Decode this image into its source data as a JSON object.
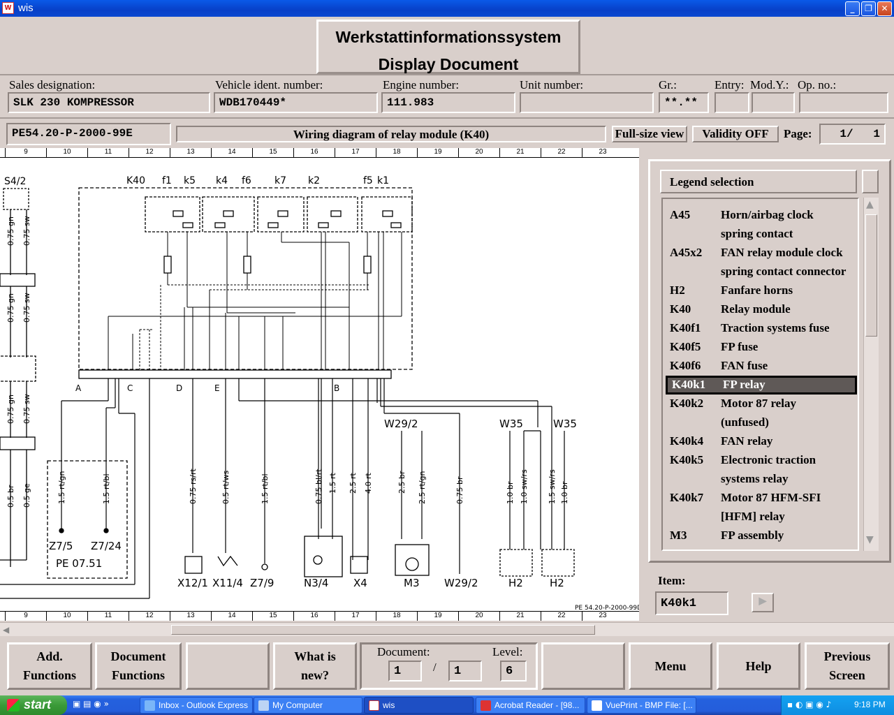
{
  "window": {
    "title": "wis"
  },
  "header": {
    "line1": "Werkstattinformationssystem",
    "line2": "Display Document"
  },
  "vehicle": {
    "sales_label": "Sales designation:",
    "sales_value": "SLK 230 KOMPRESSOR",
    "vin_label": "Vehicle ident. number:",
    "vin_value": "WDB170449*",
    "engine_label": "Engine number:",
    "engine_value": "111.983",
    "unit_label": "Unit number:",
    "unit_value": "",
    "gr_label": "Gr.:",
    "gr_value": "**.**",
    "entry_label": "Entry:",
    "entry_value": "",
    "mody_label": "Mod.Y.:",
    "mody_value": "",
    "opno_label": "Op. no.:",
    "opno_value": ""
  },
  "doc": {
    "id": "PE54.20-P-2000-99E",
    "title": "Wiring diagram of relay module (K40)",
    "fullsize": "Full-size view",
    "validity": "Validity OFF",
    "page_label": "Page:",
    "page_value": "1/   1"
  },
  "ruler": [
    "9",
    "10",
    "11",
    "12",
    "13",
    "14",
    "15",
    "16",
    "17",
    "18",
    "19",
    "20",
    "21",
    "22",
    "23"
  ],
  "diagram": {
    "footer_ref": "PE 54.20-P-2000-99D",
    "components": [
      "S4/2",
      "K40",
      "f1",
      "k5",
      "k4",
      "f6",
      "k7",
      "k2",
      "f5",
      "k1"
    ],
    "pins_top": [
      "A",
      "C",
      "D",
      "E",
      "B"
    ],
    "connectors": [
      "Z7/5",
      "Z7/24",
      "PE 07.51",
      "X12/1",
      "X11/4",
      "Z7/9",
      "N3/4",
      "X4",
      "M3",
      "W29/2",
      "H2",
      "H2",
      "W29/2",
      "W35",
      "W35"
    ],
    "wires": [
      "0.75 gn",
      "0.75 sw",
      "0.75 gn",
      "0.75 sw",
      "0.75 gn",
      "0.75 sw",
      "1.5 rt/gn",
      "1.5 rt/bl",
      "0.75 rs/rt",
      "0.5 rt/ws",
      "1.5 rt/bl",
      "0.75 bl/rt",
      "1.5 rt",
      "2.5 rt",
      "4.0 rt",
      "2.5 br",
      "2.5 rt/gn",
      "0.75 br",
      "1.0 br",
      "1.0 sw/rs",
      "1.5 sw/rs",
      "1.0 br",
      "0.5 br",
      "0.5 ge"
    ]
  },
  "legend": {
    "header": "Legend selection",
    "rows": [
      {
        "code": "A45",
        "desc": "Horn/airbag clock"
      },
      {
        "code": "",
        "desc": "spring contact"
      },
      {
        "code": "A45x2",
        "desc": "FAN relay module clock"
      },
      {
        "code": "",
        "desc": "spring contact connector"
      },
      {
        "code": "H2",
        "desc": "Fanfare horns"
      },
      {
        "code": "K40",
        "desc": "Relay module"
      },
      {
        "code": "K40f1",
        "desc": "Traction systems fuse"
      },
      {
        "code": "K40f5",
        "desc": "FP fuse"
      },
      {
        "code": "K40f6",
        "desc": "FAN fuse"
      },
      {
        "code": "K40k1",
        "desc": "FP relay",
        "selected": true
      },
      {
        "code": "K40k2",
        "desc": "Motor 87 relay"
      },
      {
        "code": "",
        "desc": "(unfused)"
      },
      {
        "code": "K40k4",
        "desc": "FAN relay"
      },
      {
        "code": "K40k5",
        "desc": "Electronic traction"
      },
      {
        "code": "",
        "desc": "systems relay"
      },
      {
        "code": "K40k7",
        "desc": "Motor 87 HFM-SFI"
      },
      {
        "code": "",
        "desc": "[HFM] relay"
      },
      {
        "code": "M3",
        "desc": "FP assembly"
      }
    ],
    "item_label": "Item:",
    "item_value": "K40k1"
  },
  "bottom": {
    "add_functions": [
      "Add.",
      "Functions"
    ],
    "document_functions": [
      "Document",
      "Functions"
    ],
    "what_is_new": [
      "What is",
      "new?"
    ],
    "document_label": "Document:",
    "document_value": "1",
    "document_sep": "/",
    "document_total": "1",
    "level_label": "Level:",
    "level_value": "6",
    "menu": "Menu",
    "help": "Help",
    "previous_screen": [
      "Previous",
      "Screen"
    ]
  },
  "taskbar": {
    "start": "start",
    "tasks": [
      "Inbox - Outlook Express",
      "My Computer",
      "wis",
      "Acrobat Reader - [98...",
      "VuePrint - BMP File: [..."
    ],
    "time": "9:18 PM"
  },
  "colors": {
    "panel": "#d9cfcb",
    "titlebar": "#0a5ae8",
    "selected_row": "#5f5957",
    "taskbar": "#245ddb"
  }
}
